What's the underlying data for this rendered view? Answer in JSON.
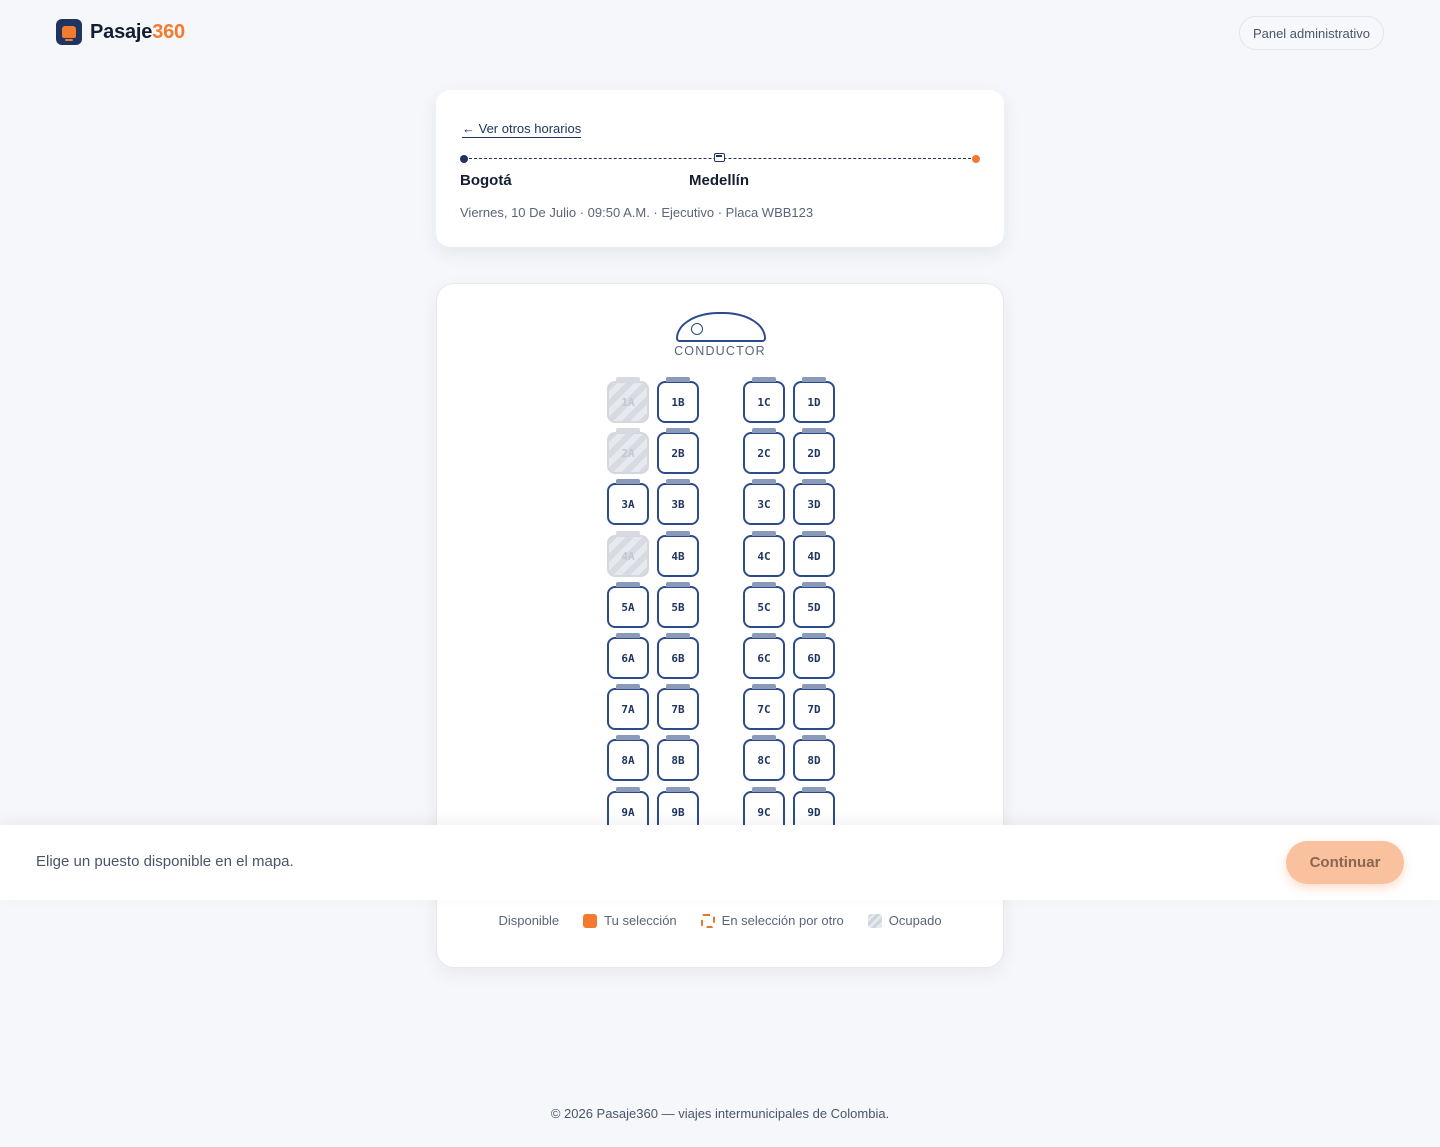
{
  "brand": {
    "name": "Pasaje",
    "accent": "360"
  },
  "header": {
    "admin_label": "Panel administrativo"
  },
  "trip": {
    "back_label": "← Ver otros horarios",
    "origin": "Bogotá",
    "destination": "Medellín",
    "meta": "Viernes, 10 De Julio · 09:50 A.M. · Ejecutivo · Placa WBB123"
  },
  "seatmap": {
    "driver_label": "CONDUCTOR",
    "rows": [
      [
        {
          "id": "1A",
          "status": "occupied"
        },
        {
          "id": "1B",
          "status": "available"
        },
        {
          "id": "1C",
          "status": "available"
        },
        {
          "id": "1D",
          "status": "available"
        }
      ],
      [
        {
          "id": "2A",
          "status": "occupied"
        },
        {
          "id": "2B",
          "status": "available"
        },
        {
          "id": "2C",
          "status": "available"
        },
        {
          "id": "2D",
          "status": "available"
        }
      ],
      [
        {
          "id": "3A",
          "status": "available"
        },
        {
          "id": "3B",
          "status": "available"
        },
        {
          "id": "3C",
          "status": "available"
        },
        {
          "id": "3D",
          "status": "available"
        }
      ],
      [
        {
          "id": "4A",
          "status": "occupied"
        },
        {
          "id": "4B",
          "status": "available"
        },
        {
          "id": "4C",
          "status": "available"
        },
        {
          "id": "4D",
          "status": "available"
        }
      ],
      [
        {
          "id": "5A",
          "status": "available"
        },
        {
          "id": "5B",
          "status": "available"
        },
        {
          "id": "5C",
          "status": "available"
        },
        {
          "id": "5D",
          "status": "available"
        }
      ],
      [
        {
          "id": "6A",
          "status": "available"
        },
        {
          "id": "6B",
          "status": "available"
        },
        {
          "id": "6C",
          "status": "available"
        },
        {
          "id": "6D",
          "status": "available"
        }
      ],
      [
        {
          "id": "7A",
          "status": "available"
        },
        {
          "id": "7B",
          "status": "available"
        },
        {
          "id": "7C",
          "status": "available"
        },
        {
          "id": "7D",
          "status": "available"
        }
      ],
      [
        {
          "id": "8A",
          "status": "available"
        },
        {
          "id": "8B",
          "status": "available"
        },
        {
          "id": "8C",
          "status": "available"
        },
        {
          "id": "8D",
          "status": "available"
        }
      ],
      [
        {
          "id": "9A",
          "status": "available"
        },
        {
          "id": "9B",
          "status": "available"
        },
        {
          "id": "9C",
          "status": "available"
        },
        {
          "id": "9D",
          "status": "available"
        }
      ]
    ]
  },
  "legend": {
    "available": "Disponible",
    "mine": "Tu selección",
    "other": "En selección por otro",
    "occupied": "Ocupado"
  },
  "bottom_bar": {
    "hint": "Elige un puesto disponible en el mapa.",
    "continue_label": "Continuar"
  },
  "footer": {
    "text": "© 2026 Pasaje360 — viajes intermunicipales de Colombia."
  },
  "colors": {
    "primary": "#1f3560",
    "accent": "#f47a2f",
    "continue_disabled": "#f9c19e"
  }
}
